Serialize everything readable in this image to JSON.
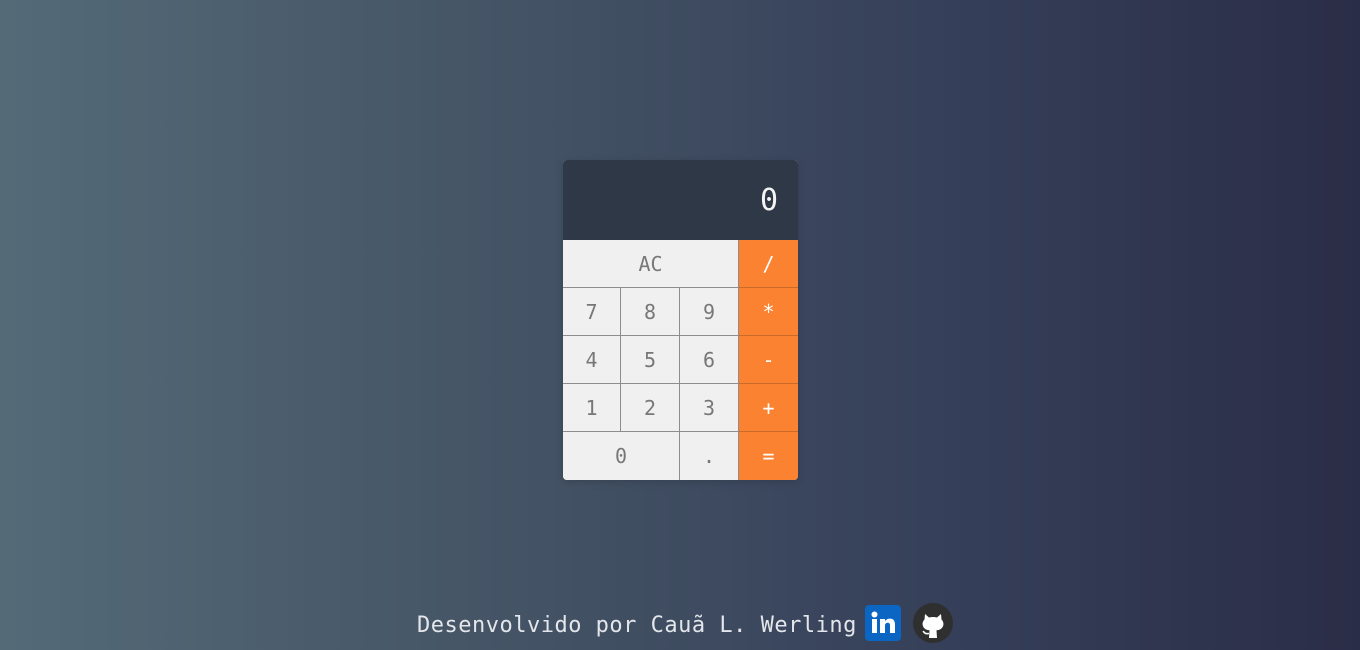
{
  "calculator": {
    "display_value": "0",
    "keys": {
      "clear": "AC",
      "divide": "/",
      "seven": "7",
      "eight": "8",
      "nine": "9",
      "multiply": "*",
      "four": "4",
      "five": "5",
      "six": "6",
      "subtract": "-",
      "one": "1",
      "two": "2",
      "three": "3",
      "add": "+",
      "zero": "0",
      "decimal": ".",
      "equals": "="
    },
    "colors": {
      "display_bg": "#2e3846",
      "key_bg": "#f0f0f0",
      "operator_bg": "#fa8231"
    }
  },
  "footer": {
    "credit": "Desenvolvido por Cauã L. Werling",
    "icons": [
      "linkedin-icon",
      "github-icon"
    ],
    "colors": {
      "linkedin": "#0a66c2",
      "github": "#2f2f2f"
    }
  }
}
